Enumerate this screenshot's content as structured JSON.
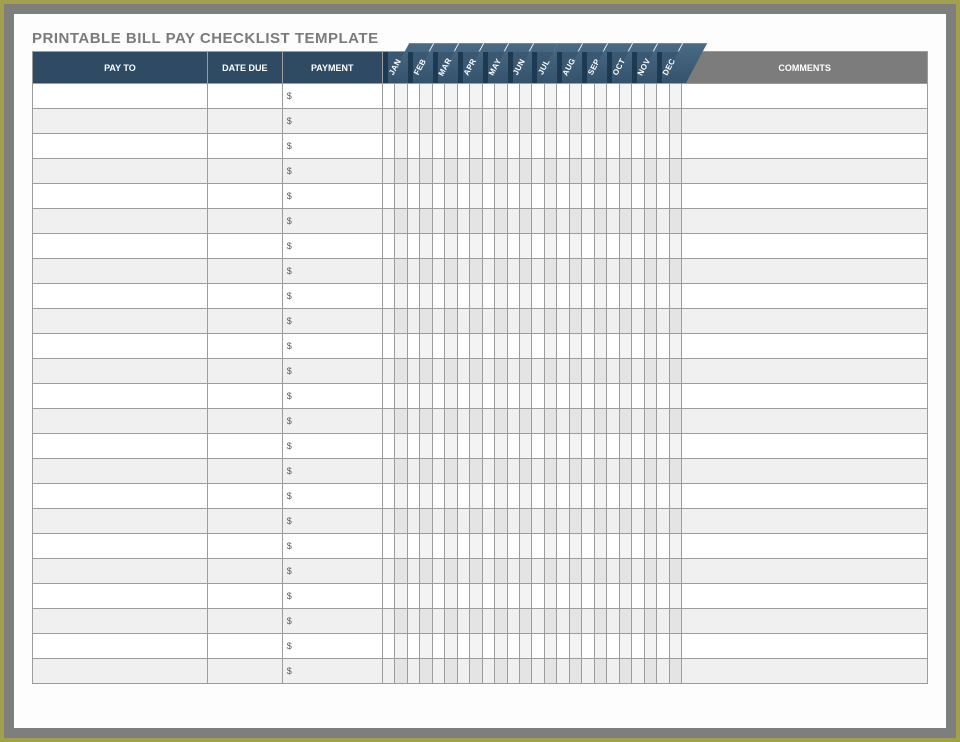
{
  "title": "PRINTABLE BILL PAY CHECKLIST TEMPLATE",
  "headers": {
    "pay_to": "PAY TO",
    "date_due": "DATE DUE",
    "payment": "PAYMENT",
    "comments": "COMMENTS"
  },
  "months": [
    "JAN",
    "FEB",
    "MAR",
    "APR",
    "MAY",
    "JUN",
    "JUL",
    "AUG",
    "SEP",
    "OCT",
    "NOV",
    "DEC"
  ],
  "payment_prefix": "$",
  "row_count": 24,
  "colors": {
    "header_dark": "#2f4b64",
    "header_month": "#3a5872",
    "header_comments": "#7c7c7c",
    "frame_outer": "#a3a04d",
    "frame_inner": "#7e7e7e",
    "alt_row": "#f0f0f0"
  }
}
